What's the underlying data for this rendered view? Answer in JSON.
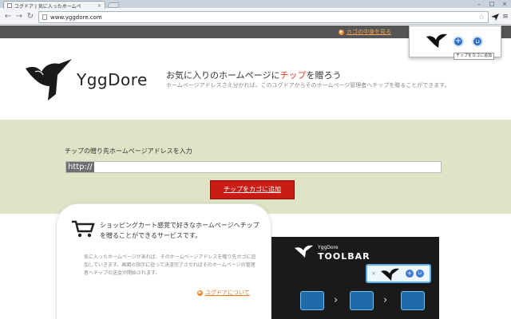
{
  "browser": {
    "tab_title": "ユグドア | 気に入ったホームペ",
    "tab_close": "×",
    "url": "www.yggdore.com",
    "window_controls": [
      "–",
      "□",
      "×"
    ]
  },
  "header": {
    "cart_link": "カゴの中身を見る"
  },
  "brand": {
    "logo_text": "YggDore",
    "tagline_prefix": "お気に入りのホームページに",
    "tagline_highlight": "チップ",
    "tagline_suffix": "を贈ろう",
    "subtagline": "ホームページアドレスさえ分かれば、このユグドアからそのホームページ管理者へチップを贈ることができます。"
  },
  "tip_form": {
    "label": "チップの贈り先ホームページアドレスを入力",
    "url_value": "http://",
    "add_button": "チップをカゴに追加"
  },
  "info_card": {
    "heading": "ショッピングカート感覚で好きなホームページへチップを贈ることができるサービスです。",
    "body": "気に入ったホームページがあれば、そのホームページアドレスを贈り先カゴに追加していきます。画面の指示に従って決済完了させればそのホームページの管理者へチップの送金が開始されます。",
    "about_link": "ユグドアについて"
  },
  "promo": {
    "brand_small": "YggDore",
    "brand_big": "TOOLBAR",
    "close_x": "×"
  },
  "extension_popup": {
    "tooltip": "チップをカゴに追加"
  },
  "colors": {
    "accent_red": "#c81c14",
    "band_olive": "#e1e3c6",
    "link_orange": "#e87722",
    "topbar_gray": "#555555"
  }
}
